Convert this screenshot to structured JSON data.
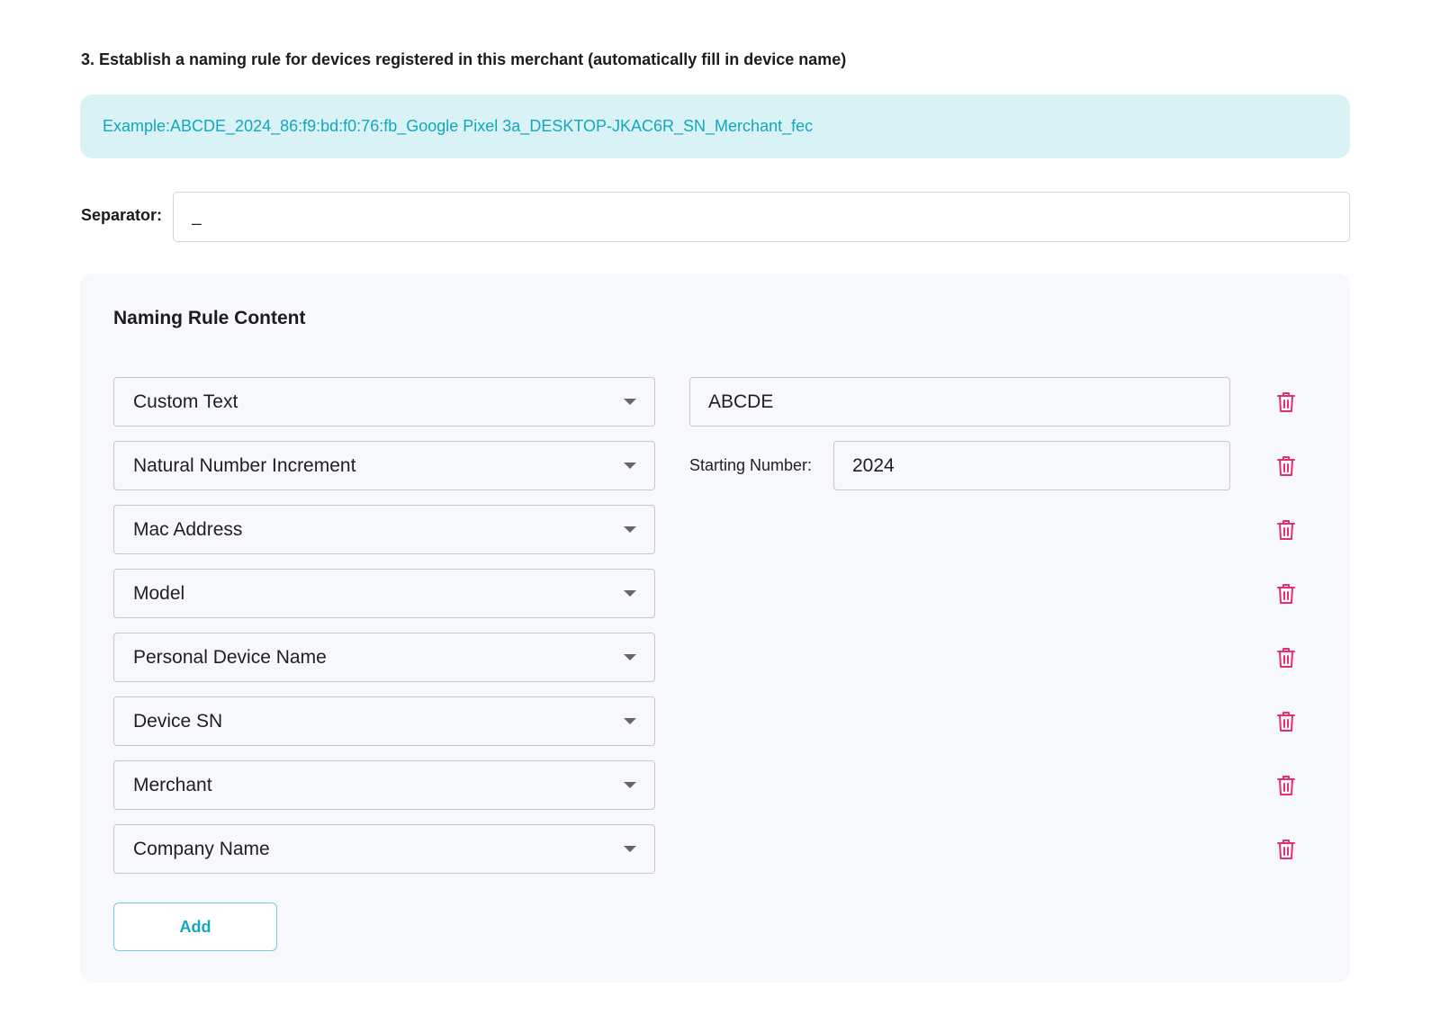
{
  "section": {
    "title": "3. Establish a naming rule for devices registered in this merchant (automatically fill in device name)",
    "example": "Example:ABCDE_2024_86:f9:bd:f0:76:fb_Google Pixel 3a_DESKTOP-JKAC6R_SN_Merchant_fec"
  },
  "separator": {
    "label": "Separator:",
    "value": "_"
  },
  "panel": {
    "title": "Naming Rule Content",
    "rules": [
      {
        "type": "Custom Text",
        "value": "ABCDE"
      },
      {
        "type": "Natural Number Increment",
        "value_label": "Starting Number:",
        "value": "2024"
      },
      {
        "type": "Mac Address"
      },
      {
        "type": "Model"
      },
      {
        "type": "Personal Device Name"
      },
      {
        "type": "Device SN"
      },
      {
        "type": "Merchant"
      },
      {
        "type": "Company Name"
      }
    ],
    "add_label": "Add"
  },
  "colors": {
    "accent": "#12a7bd",
    "example_bg": "#d9f2f6",
    "delete": "#e2306c",
    "panel_bg": "#f7f8fb"
  },
  "icons": {
    "select_caret": "caret-down-icon",
    "delete": "trash-icon"
  }
}
